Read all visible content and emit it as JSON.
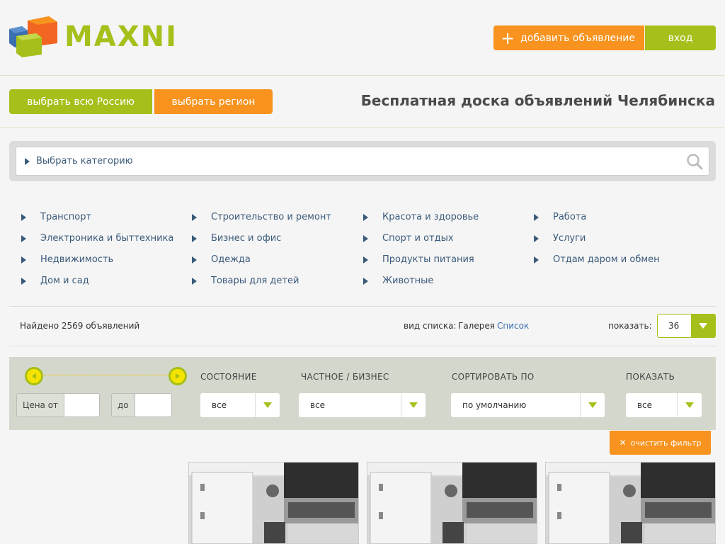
{
  "header": {
    "logo_text": "MAXNI",
    "add_ad_label": "добавить объявление",
    "login_label": "вход"
  },
  "region": {
    "all_russia_label": "выбрать всю Россию",
    "select_region_label": "выбрать регион",
    "site_title": "Бесплатная доска объявлений Челябинска"
  },
  "category_search": {
    "label": "Выбрать категорию"
  },
  "categories": [
    [
      "Транспорт",
      "Электроника и быттехника",
      "Недвижимость",
      "Дом и сад"
    ],
    [
      "Строительство и ремонт",
      "Бизнес и офис",
      "Одежда",
      "Товары для детей"
    ],
    [
      "Красота и здоровье",
      "Спорт и отдых",
      "Продукты питания",
      "Животные"
    ],
    [
      "Работа",
      "Услуги",
      "Отдам даром и обмен"
    ]
  ],
  "results": {
    "found_text": "Найдено 2569 объявлений",
    "view_label": "вид списка:",
    "view_gallery": "Галерея",
    "view_list": "Список",
    "show_label": "показать:",
    "show_value": "36"
  },
  "filter": {
    "price_from_label": "Цена от",
    "price_to_label": "до",
    "condition_label": "СОСТОЯНИЕ",
    "condition_value": "все",
    "private_label": "ЧАСТНОЕ / БИЗНЕС",
    "private_value": "все",
    "sort_label": "СОРТИРОВАТЬ ПО",
    "sort_value": "по умолчанию",
    "show_label": "ПОКАЗАТЬ",
    "show_value": "все",
    "clear_label": "очистить фильтр"
  },
  "colors": {
    "green": "#a6bf1a",
    "orange": "#f7931e",
    "link": "#3a5a7a"
  },
  "icons": [
    "logo-cubes-icon",
    "plus-icon",
    "search-icon",
    "triangle-right-icon",
    "chevron-down-icon",
    "close-icon"
  ]
}
